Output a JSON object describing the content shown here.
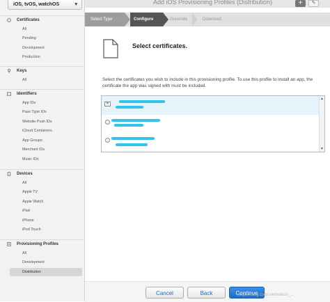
{
  "app": {
    "title": "Add iOS Provisioning Profiles (Distribution)"
  },
  "toolbar": {
    "add_label": "+",
    "edit_label": "✎"
  },
  "sidebar": {
    "platform": "iOS, tvOS, watchOS",
    "sections": [
      {
        "label": "Certificates",
        "icon": "certificate-icon",
        "items": [
          "All",
          "Pending",
          "Development",
          "Production"
        ]
      },
      {
        "label": "Keys",
        "icon": "key-icon",
        "items": [
          "All"
        ]
      },
      {
        "label": "Identifiers",
        "icon": "id-card-icon",
        "items": [
          "App IDs",
          "Pass Type IDs",
          "Website Push IDs",
          "iCloud Containers",
          "App Groups",
          "Merchant IDs",
          "Music IDs"
        ]
      },
      {
        "label": "Devices",
        "icon": "device-icon",
        "items": [
          "All",
          "Apple TV",
          "Apple Watch",
          "iPad",
          "iPhone",
          "iPod Touch"
        ]
      },
      {
        "label": "Provisioning Profiles",
        "icon": "profile-icon",
        "items": [
          "All",
          "Development",
          "Distribution"
        ],
        "active_item": "Distribution"
      }
    ]
  },
  "steps": [
    "Select Type",
    "Configure",
    "Generate",
    "Download"
  ],
  "active_step": "Configure",
  "main": {
    "heading": "Select certificates.",
    "description": "Select the certificates you wish to include in this provisioning profile. To use this profile to install an app, the certificate the app was signed with must be included."
  },
  "buttons": {
    "cancel": "Cancel",
    "back": "Back",
    "continue": "Continue"
  },
  "watermark": "https://blog.csdn.net/weixin_...",
  "colors": {
    "accent": "#1f6cc7",
    "redaction": "#33c4ec",
    "selected_row": "#e5f3fb"
  }
}
